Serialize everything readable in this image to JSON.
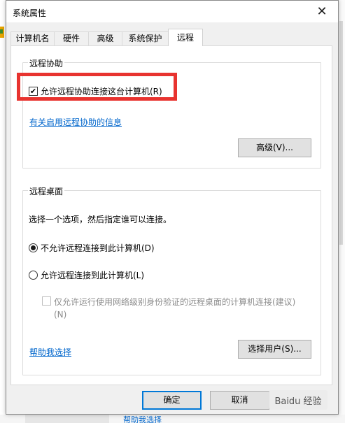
{
  "window": {
    "title": "系统属性",
    "close_glyph": "✕"
  },
  "tabs": [
    {
      "label": "计算机名"
    },
    {
      "label": "硬件"
    },
    {
      "label": "高级"
    },
    {
      "label": "系统保护"
    },
    {
      "label": "远程",
      "active": true
    }
  ],
  "remote_assistance": {
    "group_title": "远程协助",
    "allow_checkbox_label": "允许远程协助连接这台计算机(R)",
    "allow_checked": true,
    "info_link": "有关启用远程协助的信息",
    "advanced_button": "高级(V)..."
  },
  "remote_desktop": {
    "group_title": "远程桌面",
    "instruction": "选择一个选项，然后指定谁可以连接。",
    "option_deny": "不允许远程连接到此计算机(D)",
    "option_allow": "允许远程连接到此计算机(L)",
    "selected_option": "deny",
    "nla_checkbox_label_line1": "仅允许运行使用网络级别身份验证的远程桌面的计算机连接(建议)",
    "nla_checkbox_label_line2": "(N)",
    "nla_checked": false,
    "nla_enabled": false,
    "help_link": "帮助我选择",
    "select_users_button": "选择用户(S)..."
  },
  "footer": {
    "ok_button": "确定",
    "cancel_button": "取消"
  },
  "background": {
    "bottom_link": "帮助我选择"
  },
  "watermark": "Baidu 经验",
  "colors": {
    "highlight": "#e8332f",
    "accent": "#0078d7",
    "link": "#0066cc"
  }
}
